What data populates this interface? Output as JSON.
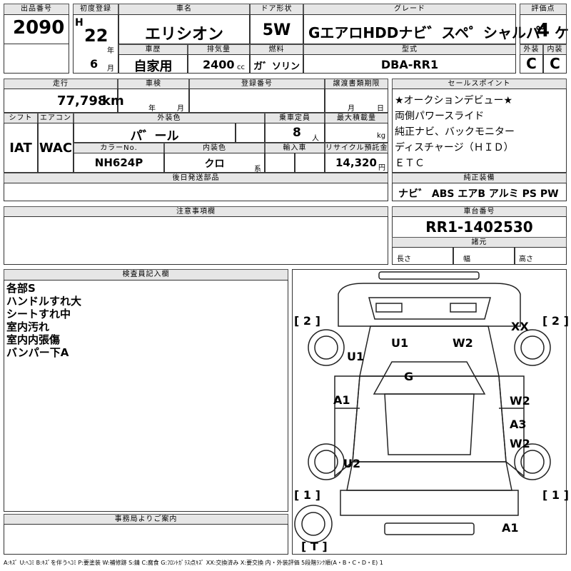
{
  "header": {
    "lot_label": "出品番号",
    "lot": "2090",
    "first_reg_label": "初度登録",
    "era": "H",
    "year": "22",
    "year_unit": "年",
    "month": "6",
    "month_unit": "月",
    "name_label": "車名",
    "name": "エリシオン",
    "door_label": "ドア形状",
    "door": "5W",
    "grade_label": "グレード",
    "grade": "GエアロHDDナビ゛スペ゜シャルパ゜ケ",
    "score_label": "評価点",
    "score": "4",
    "history_label": "車歴",
    "history": "自家用",
    "disp_label": "排気量",
    "disp": "2400",
    "disp_unit": "cc",
    "fuel_label": "燃料",
    "fuel": "ガ゛ソリン",
    "model_label": "型式",
    "model": "DBA-RR1",
    "ext_label": "外装",
    "ext": "C",
    "int_label": "内装",
    "int": "C"
  },
  "row2": {
    "mileage_label": "走行",
    "mileage": "77,798",
    "mileage_unit": "km",
    "inspect_label": "車検",
    "inspect_year": "年",
    "inspect_month": "月",
    "regno_label": "登録番号",
    "transfer_label": "譲渡書類期限",
    "transfer_month": "月",
    "transfer_day": "日",
    "shift_label": "シフト",
    "shift": "IAT",
    "ac_label": "エアコン",
    "ac": "WAC",
    "color_label": "外装色",
    "color": "パ゛ール",
    "capacity_label": "乗車定員",
    "capacity": "8",
    "capacity_unit": "人",
    "load_label": "最大積載量",
    "load_unit": "kg",
    "colorno_label": "カラーNo.",
    "colorno": "NH624P",
    "intcolor_label": "内装色",
    "intcolor": "クロ",
    "intcolor_unit": "系",
    "import_label": "輸入車",
    "recycle_label": "リサイクル預託金",
    "recycle": "14,320",
    "recycle_unit": "円",
    "later_label": "後日発送部品"
  },
  "sales": {
    "label": "セールスポイント",
    "items": [
      "★オークションデビュー★",
      "両側パワースライド",
      "純正ナビ、バックモニター",
      "ディスチャージ（ＨＩＤ）",
      "ＥＴＣ"
    ]
  },
  "equipment": {
    "label": "純正装備",
    "text": "ナビ゛ ABS エアB アルミ PS PW"
  },
  "notes": {
    "label": "注意事項欄"
  },
  "chassis": {
    "label": "車台番号",
    "value": "RR1-1402530"
  },
  "specs": {
    "label": "諸元",
    "length": "長さ",
    "width": "幅",
    "height": "高さ"
  },
  "inspector": {
    "label": "検査員記入欄",
    "lines": [
      "各部S",
      "ハンドルすれ大",
      "シートすれ中",
      "室内汚れ",
      "室内内張傷",
      "バンパー下A"
    ]
  },
  "office": {
    "label": "事務局よりご案内"
  },
  "diagram": {
    "marks": {
      "u1_roof": "U1",
      "w2_roof": "W2",
      "g": "G",
      "u1_left": "U1",
      "xx": "XX",
      "a1_left": "A1",
      "w2_right1": "W2",
      "a3": "A3",
      "w2_right2": "W2",
      "u2": "U2",
      "a1_bottom": "A1",
      "tire_fl": "[ 2 ]",
      "tire_fr": "[ 2 ]",
      "tire_rl": "[ 1 ]",
      "tire_rr": "[ 1 ]",
      "spare": "[ T ]"
    }
  },
  "legend": "A:ｷｽﾞ U:ﾍｺﾐ B:ｷｽﾞを伴うﾍｺﾐ P:要塗装 W:補修跡 S:錆 C:腐食 G:ﾌﾛﾝﾄｶﾞﾗｽ点ｷｽﾞ XX:交換済み X:要交換 内・外装評価 5段階ﾗﾝｸ順(A・B・C・D・E) 1"
}
